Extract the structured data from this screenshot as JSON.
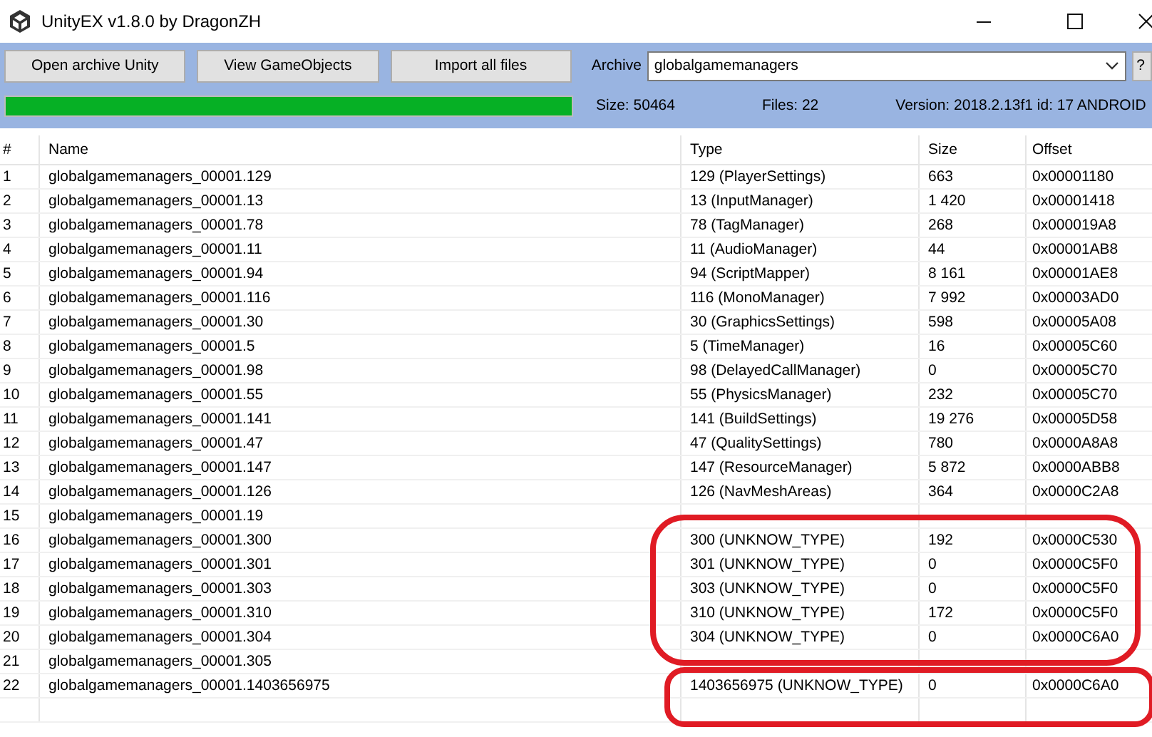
{
  "window": {
    "title": "UnityEX v1.8.0 by DragonZH"
  },
  "toolbar": {
    "buttons": [
      "Open archive Unity",
      "View GameObjects",
      "Import all files"
    ],
    "archive_label": "Archive",
    "archive_value": "globalgamemanagers",
    "help_button": "?"
  },
  "progress": {
    "level": 1
  },
  "status": {
    "size": "Size: 50464",
    "files": "Files: 22",
    "version": "Version: 2018.2.13f1 id: 17 ANDROID"
  },
  "table": {
    "columns": [
      "#",
      "Name",
      "Type",
      "Size",
      "Offset"
    ],
    "rows": [
      {
        "num": "1",
        "name": "globalgamemanagers_00001.129",
        "type": "129 (PlayerSettings)",
        "size": "663",
        "offset": "0x00001180"
      },
      {
        "num": "2",
        "name": "globalgamemanagers_00001.13",
        "type": "13 (InputManager)",
        "size": "1 420",
        "offset": "0x00001418"
      },
      {
        "num": "3",
        "name": "globalgamemanagers_00001.78",
        "type": "78 (TagManager)",
        "size": "268",
        "offset": "0x000019A8"
      },
      {
        "num": "4",
        "name": "globalgamemanagers_00001.11",
        "type": "11 (AudioManager)",
        "size": "44",
        "offset": "0x00001AB8"
      },
      {
        "num": "5",
        "name": "globalgamemanagers_00001.94",
        "type": "94 (ScriptMapper)",
        "size": "8 161",
        "offset": "0x00001AE8"
      },
      {
        "num": "6",
        "name": "globalgamemanagers_00001.116",
        "type": "116 (MonoManager)",
        "size": "7 992",
        "offset": "0x00003AD0"
      },
      {
        "num": "7",
        "name": "globalgamemanagers_00001.30",
        "type": "30 (GraphicsSettings)",
        "size": "598",
        "offset": "0x00005A08"
      },
      {
        "num": "8",
        "name": "globalgamemanagers_00001.5",
        "type": "5 (TimeManager)",
        "size": "16",
        "offset": "0x00005C60"
      },
      {
        "num": "9",
        "name": "globalgamemanagers_00001.98",
        "type": "98 (DelayedCallManager)",
        "size": "0",
        "offset": "0x00005C70"
      },
      {
        "num": "10",
        "name": "globalgamemanagers_00001.55",
        "type": "55 (PhysicsManager)",
        "size": "232",
        "offset": "0x00005C70"
      },
      {
        "num": "11",
        "name": "globalgamemanagers_00001.141",
        "type": "141 (BuildSettings)",
        "size": "19 276",
        "offset": "0x00005D58"
      },
      {
        "num": "12",
        "name": "globalgamemanagers_00001.47",
        "type": "47 (QualitySettings)",
        "size": "780",
        "offset": "0x0000A8A8"
      },
      {
        "num": "13",
        "name": "globalgamemanagers_00001.147",
        "type": "147 (ResourceManager)",
        "size": "5 872",
        "offset": "0x0000ABB8"
      },
      {
        "num": "14",
        "name": "globalgamemanagers_00001.126",
        "type": "126 (NavMeshAreas)",
        "size": "364",
        "offset": "0x0000C2A8"
      },
      {
        "num": "15",
        "name": "globalgamemanagers_00001.19"
      },
      {
        "num": "16",
        "name": "globalgamemanagers_00001.300",
        "type": "300 (UNKNOW_TYPE)",
        "size": "192",
        "offset": "0x0000C530"
      },
      {
        "num": "17",
        "name": "globalgamemanagers_00001.301",
        "type": "301 (UNKNOW_TYPE)",
        "size": "0",
        "offset": "0x0000C5F0"
      },
      {
        "num": "18",
        "name": "globalgamemanagers_00001.303",
        "type": "303 (UNKNOW_TYPE)",
        "size": "0",
        "offset": "0x0000C5F0"
      },
      {
        "num": "19",
        "name": "globalgamemanagers_00001.310",
        "type": "310 (UNKNOW_TYPE)",
        "size": "172",
        "offset": "0x0000C5F0"
      },
      {
        "num": "20",
        "name": "globalgamemanagers_00001.304",
        "type": "304 (UNKNOW_TYPE)",
        "size": "0",
        "offset": "0x0000C6A0"
      },
      {
        "num": "21",
        "name": "globalgamemanagers_00001.305"
      },
      {
        "num": "22",
        "name": "globalgamemanagers_00001.1403656975",
        "type": "1403656975 (UNKNOW_TYPE)",
        "size": "0",
        "offset": "0x0000C6A0"
      }
    ]
  },
  "annotations": [
    {
      "kind": "large"
    },
    {
      "kind": "small"
    }
  ]
}
